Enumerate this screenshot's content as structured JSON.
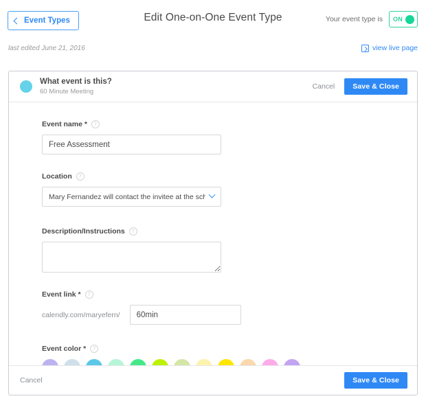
{
  "topbar": {
    "back_label": "Event Types",
    "title": "Edit One-on-One Event Type",
    "toggle_label": "Your event type is",
    "toggle_state": "ON",
    "toggle_color": "#17d698"
  },
  "meta": {
    "last_edited": "last edited June 21, 2016",
    "view_live_page": "view live page"
  },
  "card": {
    "header": {
      "title": "What event is this?",
      "subtitle": "60 Minute Meeting",
      "dot_color": "#64d2e8",
      "cancel_label": "Cancel",
      "save_label": "Save & Close"
    },
    "fields": {
      "event_name": {
        "label": "Event name *",
        "help": "?",
        "value": "Free Assessment",
        "placeholder": ""
      },
      "location": {
        "label": "Location",
        "help": "?",
        "value": "Mary Fernandez will contact the invitee at the sched.."
      },
      "description": {
        "label": "Description/Instructions",
        "help": "?",
        "value": "",
        "placeholder": ""
      },
      "event_link": {
        "label": "Event link *",
        "help": "?",
        "prefix": "calendly.com/maryefern/",
        "value": "60min",
        "placeholder": ""
      },
      "event_color": {
        "label": "Event color *",
        "help": "?",
        "selected_index": 2,
        "swatches": [
          {
            "name": "lavender",
            "hex": "#bdb2f0"
          },
          {
            "name": "pale-blue",
            "hex": "#cfe0ea"
          },
          {
            "name": "sky-blue",
            "hex": "#5bc8e8"
          },
          {
            "name": "mint",
            "hex": "#b6f5d8"
          },
          {
            "name": "green",
            "hex": "#46e88a"
          },
          {
            "name": "lime",
            "hex": "#bdf205"
          },
          {
            "name": "sage",
            "hex": "#d4e6a5"
          },
          {
            "name": "pale-yellow",
            "hex": "#fcf3ae"
          },
          {
            "name": "yellow",
            "hex": "#ffe600"
          },
          {
            "name": "peach",
            "hex": "#fbd8ad"
          },
          {
            "name": "pink",
            "hex": "#ffabea"
          },
          {
            "name": "violet",
            "hex": "#c3a4f2"
          }
        ]
      }
    },
    "footer": {
      "cancel_label": "Cancel",
      "save_label": "Save & Close"
    }
  }
}
